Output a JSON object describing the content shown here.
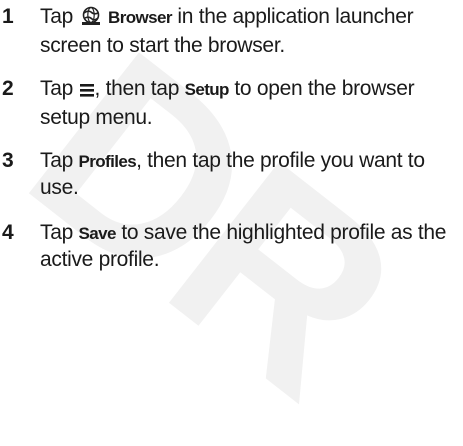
{
  "watermark": "DR",
  "steps": [
    {
      "num": "1",
      "pre": "Tap ",
      "icon": "browser-globe-icon",
      "kw": "Browser",
      "post": " in the application launcher screen to start the browser."
    },
    {
      "num": "2",
      "pre": "Tap ",
      "icon": "menu-icon",
      "mid": ", then tap ",
      "kw": "Setup",
      "post": " to open the browser setup menu."
    },
    {
      "num": "3",
      "pre": "Tap ",
      "kw": "Profiles",
      "post": ", then tap the profile you want to use."
    },
    {
      "num": "4",
      "pre": "Tap ",
      "kw": "Save",
      "post": " to save the highlighted profile as the active profile."
    }
  ]
}
